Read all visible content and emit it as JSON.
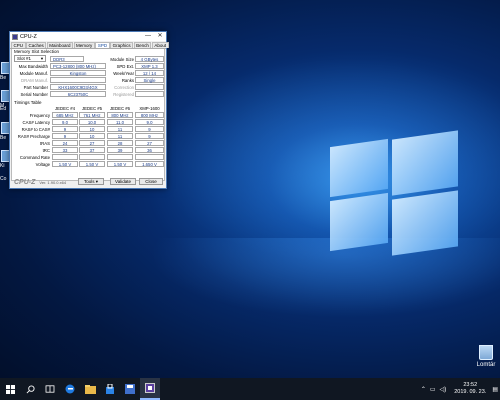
{
  "window": {
    "title": "CPU-Z",
    "minimize": "—",
    "maximize": "☐",
    "close": "✕"
  },
  "tabs": [
    "CPU",
    "Caches",
    "Mainboard",
    "Memory",
    "SPD",
    "Graphics",
    "Bench",
    "About"
  ],
  "active_tab": "SPD",
  "memory_slot": {
    "section_title": "Memory Slot Selection",
    "selected_slot": "Slot #1",
    "type": "DDR3",
    "max_bandwidth": {
      "label": "Max Bandwidth",
      "value": "PC3-12800 (800 MHz)"
    },
    "module_manuf": {
      "label": "Module Manuf.",
      "value": "Kingston"
    },
    "dram_manuf": {
      "label": "DRAM Manuf.",
      "value": ""
    },
    "part_number": {
      "label": "Part Number",
      "value": "KHX1600C9D3/4GX"
    },
    "serial_number": {
      "label": "Serial Number",
      "value": "6C23750C"
    },
    "module_size": {
      "label": "Module Size",
      "value": "4 GBytes"
    },
    "spd_ext": {
      "label": "SPD Ext.",
      "value": "XMP 1.3"
    },
    "week_year": {
      "label": "Week/Year",
      "value": "12 / 14"
    },
    "ranks": {
      "label": "Ranks",
      "value": "Single"
    },
    "correction": {
      "label": "Correction",
      "value": ""
    },
    "registered": {
      "label": "Registered",
      "value": ""
    }
  },
  "timings": {
    "section_title": "Timings Table",
    "columns": [
      "JEDEC #4",
      "JEDEC #5",
      "JEDEC #6",
      "XMP-1600"
    ],
    "rows": [
      {
        "label": "Frequency",
        "values": [
          "685 MHz",
          "761 MHz",
          "800 MHz",
          "800 MHz"
        ]
      },
      {
        "label": "CAS# Latency",
        "values": [
          "9.0",
          "10.0",
          "11.0",
          "9.0"
        ]
      },
      {
        "label": "RAS# to CAS#",
        "values": [
          "9",
          "10",
          "11",
          "9"
        ]
      },
      {
        "label": "RAS# Precharge",
        "values": [
          "9",
          "10",
          "11",
          "9"
        ]
      },
      {
        "label": "tRAS",
        "values": [
          "24",
          "27",
          "28",
          "27"
        ]
      },
      {
        "label": "tRC",
        "values": [
          "33",
          "37",
          "39",
          "36"
        ]
      },
      {
        "label": "Command Rate",
        "values": [
          "",
          "",
          "",
          ""
        ]
      },
      {
        "label": "Voltage",
        "values": [
          "1.50 V",
          "1.50 V",
          "1.50 V",
          "1.650 V"
        ]
      }
    ]
  },
  "bottom": {
    "brand": "CPU-Z",
    "version": "Ver. 1.90.0.x64",
    "tools": "Tools",
    "validate": "Validate",
    "close": "Close"
  },
  "desktop": {
    "recycle_bin_label": "Lomtár",
    "left_icon_labels": [
      "Be",
      "M",
      "Ed",
      "Be",
      "Ki",
      "Co"
    ]
  },
  "taskbar": {
    "items": [
      "windows-start-icon",
      "search-icon",
      "task-view-icon",
      "edge-icon",
      "explorer-icon",
      "store-icon",
      "save-app-icon",
      "cpuz-icon"
    ],
    "time": "23:52",
    "date": "2019. 09. 23."
  }
}
